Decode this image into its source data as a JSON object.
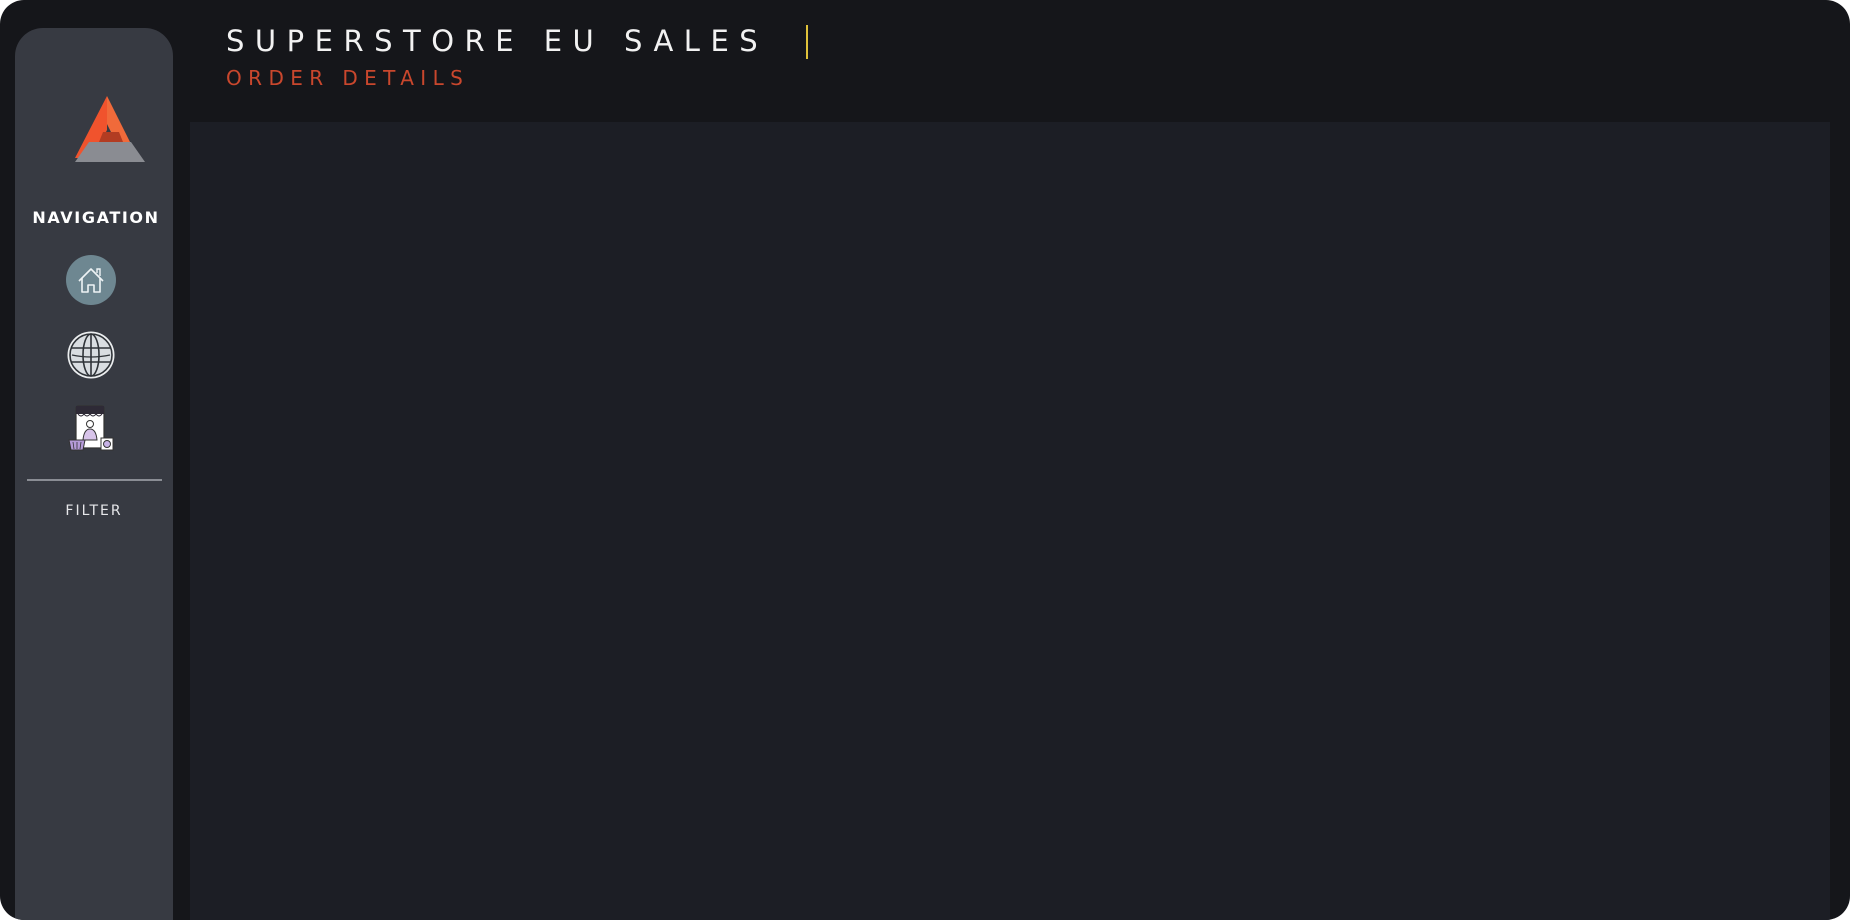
{
  "header": {
    "title": "SUPERSTORE EU SALES",
    "subtitle": "ORDER DETAILS"
  },
  "sidebar": {
    "logo": "triangle-logo",
    "navigation_label": "NAVIGATION",
    "items": [
      {
        "icon": "home-icon"
      },
      {
        "icon": "globe-icon"
      },
      {
        "icon": "store-shopping-icon"
      }
    ],
    "filter_label": "FILTER"
  },
  "colors": {
    "background": "#15161a",
    "sidebar": "#373a42",
    "content": "#1c1e25",
    "title": "#f2f2f2",
    "subtitle_accent": "#c9472d",
    "cursor_accent": "#e0c23a",
    "logo_orange": "#f0532d"
  }
}
